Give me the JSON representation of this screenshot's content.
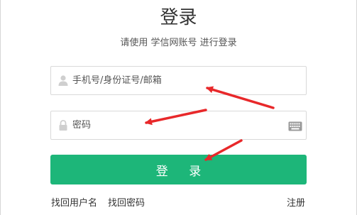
{
  "title": "登录",
  "subtitle": "请使用 学信网账号 进行登录",
  "form": {
    "username_placeholder": "手机号/身份证号/邮箱",
    "password_placeholder": "密码",
    "login_button": "登 录"
  },
  "links": {
    "find_username": "找回用户名",
    "find_password": "找回密码",
    "register": "注册"
  },
  "icons": {
    "user": "user-icon",
    "lock": "lock-icon",
    "keyboard": "keyboard-icon"
  },
  "colors": {
    "accent": "#1db679",
    "annotation_arrow": "#e8282a"
  }
}
